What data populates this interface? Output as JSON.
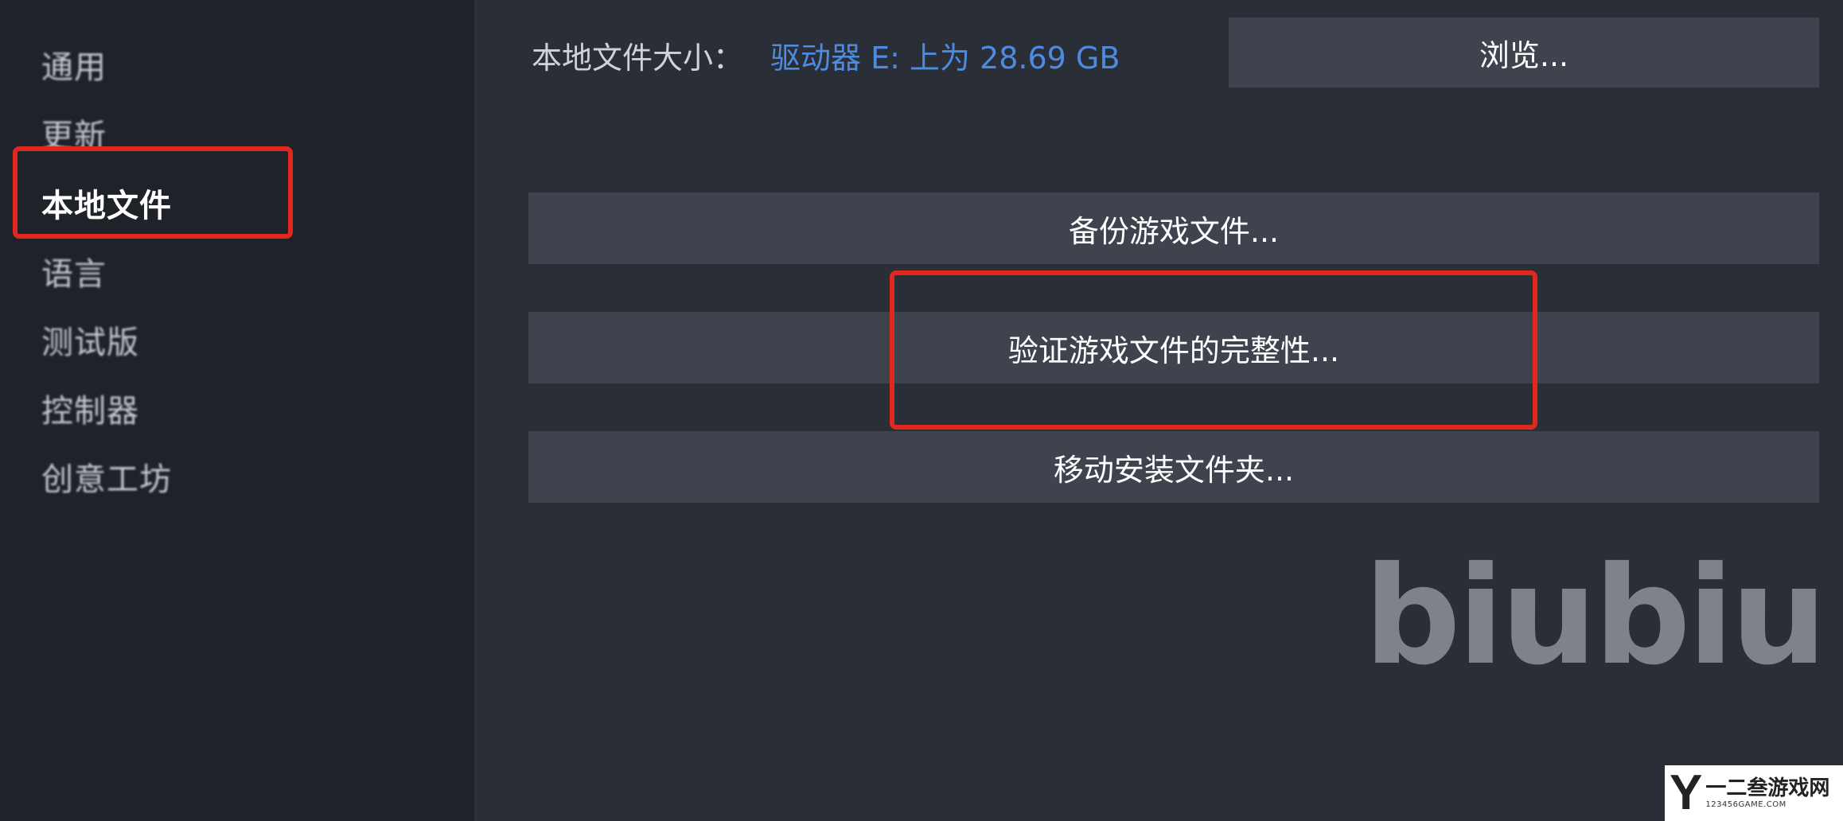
{
  "sidebar": {
    "items": [
      {
        "label": "通用"
      },
      {
        "label": "更新"
      },
      {
        "label": "本地文件"
      },
      {
        "label": "语言"
      },
      {
        "label": "测试版"
      },
      {
        "label": "控制器"
      },
      {
        "label": "创意工坊"
      }
    ],
    "active_index": 2
  },
  "main": {
    "size_label": "本地文件大小：",
    "size_value": "驱动器 E: 上为 28.69 GB",
    "browse_label": "浏览...",
    "backup_label": "备份游戏文件...",
    "verify_label": "验证游戏文件的完整性...",
    "move_label": "移动安装文件夹..."
  },
  "watermark": {
    "text": "biubiu"
  },
  "logo": {
    "letter": "Y",
    "name": "一二叁游戏网",
    "url": "123456GAME.COM"
  },
  "colors": {
    "highlight": "#e0281e",
    "link_blue": "#4d8be0",
    "button_bg": "#3e434d",
    "sidebar_bg": "#1f2229",
    "main_bg": "#2a2e37"
  }
}
